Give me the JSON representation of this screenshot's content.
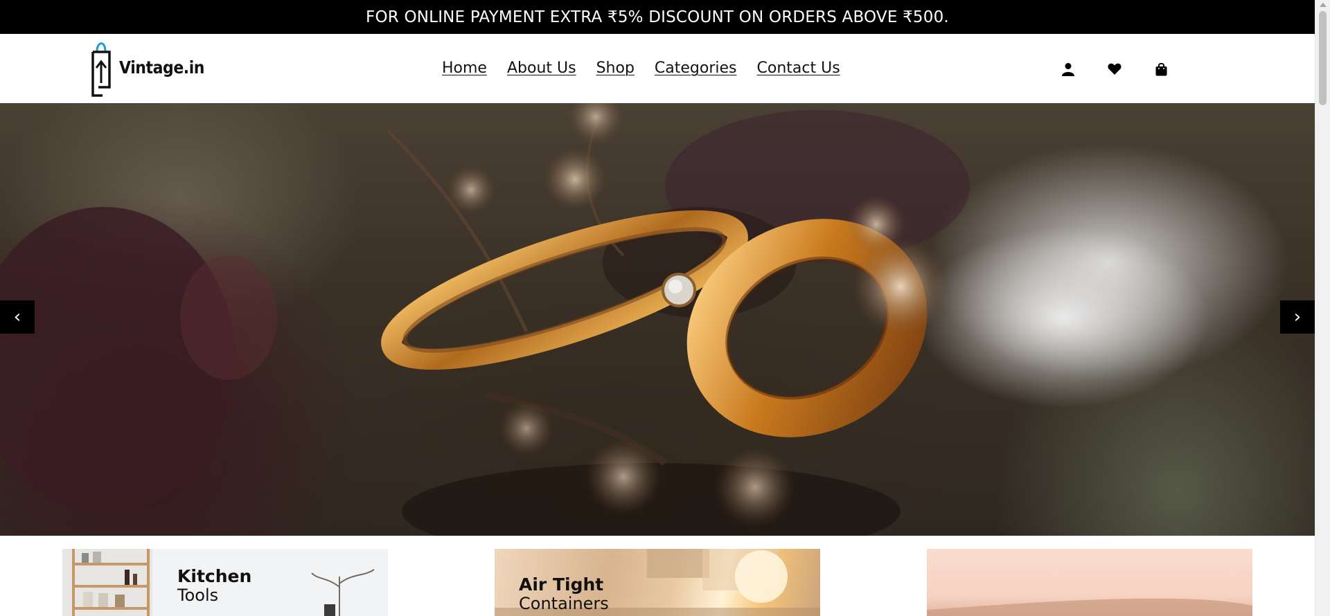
{
  "promo": {
    "text": "FOR ONLINE PAYMENT EXTRA ₹5% DISCOUNT ON ORDERS ABOVE ₹500."
  },
  "header": {
    "logo_text": "Vintage.in",
    "nav": [
      {
        "label": "Home"
      },
      {
        "label": "About Us"
      },
      {
        "label": "Shop"
      },
      {
        "label": "Categories"
      },
      {
        "label": "Contact Us"
      }
    ],
    "icons": [
      "user-icon",
      "heart-icon",
      "shopping-bag-icon"
    ]
  },
  "hero": {
    "prev_label": "‹",
    "next_label": "›",
    "image": "gold-rings-with-dried-flowers"
  },
  "categories": [
    {
      "title_bold": "Kitchen",
      "title_light": "Tools"
    },
    {
      "title_bold": "Air Tight",
      "title_light": "Containers"
    },
    {
      "title_bold": "",
      "title_light": ""
    }
  ],
  "colors": {
    "promo_bg": "#000000",
    "promo_text": "#ffffff",
    "logo_accent": "#1a9ad6",
    "text": "#111111"
  }
}
